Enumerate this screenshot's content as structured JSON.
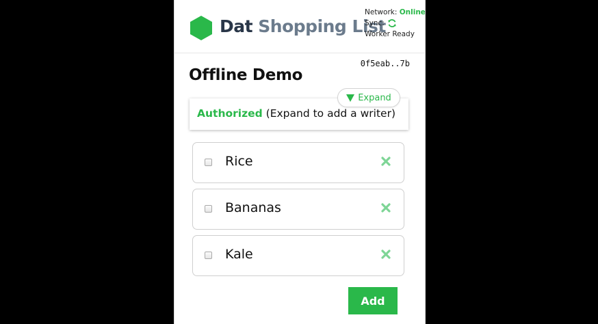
{
  "header": {
    "brand_primary": "Dat",
    "brand_secondary": "Shopping List",
    "network_label": "Network:",
    "network_value": "Online",
    "sync_label": "Sync:",
    "worker_status": "Worker Ready",
    "logo_icon": "hexagon-logo-icon",
    "sync_icon": "sync-refresh-icon"
  },
  "document": {
    "key": "0f5eab..7b",
    "title": "Offline Demo"
  },
  "auth": {
    "status": "Authorized",
    "hint": " (Expand to add a writer)",
    "expand_label": "Expand"
  },
  "items": [
    {
      "name": "Rice"
    },
    {
      "name": "Bananas"
    },
    {
      "name": "Kale"
    }
  ],
  "add_label": "Add",
  "colors": {
    "accent": "#2ab84a",
    "brand_dark": "#293648",
    "brand_grey": "#6b7b8c"
  }
}
